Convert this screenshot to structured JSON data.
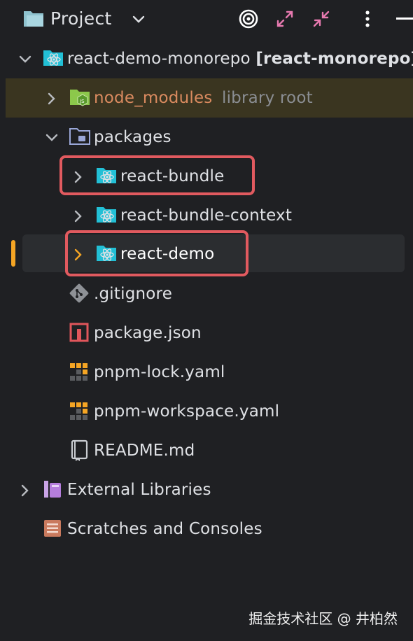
{
  "header": {
    "title": "Project",
    "icons": [
      "folder-icon",
      "chevron-down-icon",
      "target-icon",
      "expand-icon",
      "collapse-icon",
      "more-icon",
      "minimize-icon"
    ]
  },
  "tree": {
    "root": {
      "label": "react-demo-monorepo",
      "module": "[react-monorepo]"
    },
    "node_modules": {
      "label": "node_modules",
      "suffix": "library root"
    },
    "packages": {
      "label": "packages"
    },
    "react_bundle": {
      "label": "react-bundle"
    },
    "react_bundle_context": {
      "label": "react-bundle-context"
    },
    "react_demo": {
      "label": "react-demo"
    },
    "gitignore": {
      "label": ".gitignore"
    },
    "package_json": {
      "label": "package.json"
    },
    "pnpm_lock": {
      "label": "pnpm-lock.yaml"
    },
    "pnpm_workspace": {
      "label": "pnpm-workspace.yaml"
    },
    "readme": {
      "label": "README.md"
    },
    "external_libraries": {
      "label": "External Libraries"
    },
    "scratches": {
      "label": "Scratches and Consoles"
    }
  },
  "colors": {
    "background": "#1f2023",
    "text": "#dfe1e5",
    "library_highlight": "#3a3520",
    "selected_row": "#2b2d30",
    "focus_bar": "#f5a524",
    "annotation_box": "#e15a5f",
    "react_teal": "#22c0d6",
    "node_green": "#8cc84b"
  },
  "watermark": "掘金技术社区 @ 井柏然"
}
